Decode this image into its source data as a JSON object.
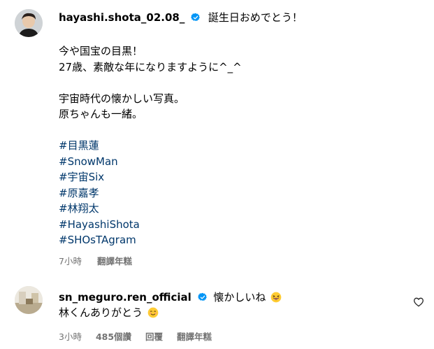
{
  "post": {
    "username": "hayashi.shota_02.08_",
    "caption_first_line": "誕生日おめでとう！",
    "caption_paragraphs": [
      [
        "今や国宝の目黒！",
        "27歳、素敵な年になりますように^_^"
      ],
      [
        "宇宙時代の懐かしい写真。",
        "原ちゃんも一緒。"
      ]
    ],
    "hashtags": [
      "#目黒蓮",
      "#SnowMan",
      "#宇宙Six",
      "#原嘉孝",
      "#林翔太",
      "#HayashiShota",
      "#SHOsTAgram"
    ],
    "time": "7小時",
    "translate_label": "翻譯年糕"
  },
  "comment": {
    "username": "sn_meguro.ren_official",
    "text_line1": "懐かしいね",
    "text_line2": "林くんありがとう",
    "emoji1": "grinning-squinting-face-emoji",
    "emoji2": "smiling-face-emoji",
    "time": "3小時",
    "likes": "485個讚",
    "reply_label": "回覆",
    "translate_label": "翻譯年糕"
  },
  "colors": {
    "hashtag": "#00376b",
    "meta": "#737373",
    "verified": "#0095f6"
  }
}
